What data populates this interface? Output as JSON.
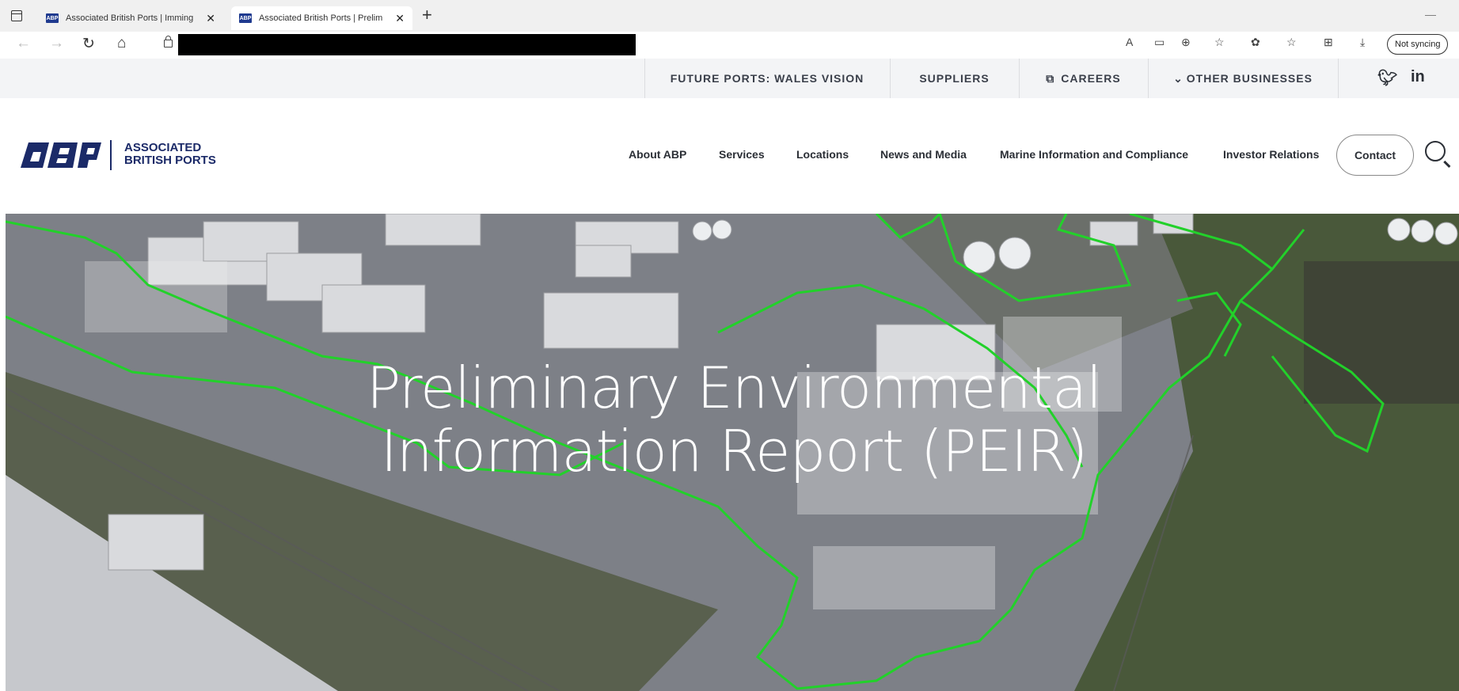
{
  "browser": {
    "tabs": [
      {
        "title": "Associated British Ports | Imming",
        "favicon": "ABP"
      },
      {
        "title": "Associated British Ports | Prelim",
        "favicon": "ABP"
      }
    ],
    "sync_label": "Not syncing"
  },
  "top_links": {
    "future_ports": "FUTURE PORTS: WALES VISION",
    "suppliers": "SUPPLIERS",
    "careers": "CAREERS",
    "other_businesses": "OTHER BUSINESSES"
  },
  "logo": {
    "line1": "ASSOCIATED",
    "line2": "BRITISH PORTS"
  },
  "main_nav": {
    "about": "About ABP",
    "services": "Services",
    "locations": "Locations",
    "news": "News and Media",
    "marine": "Marine Information and Compliance",
    "investor": "Investor Relations",
    "contact": "Contact"
  },
  "hero": {
    "title_line1": "Preliminary Environmental",
    "title_line2": "Information Report (PEIR)"
  },
  "colors": {
    "brand_blue": "#1b2a68",
    "boundary_green": "#22d12a"
  }
}
